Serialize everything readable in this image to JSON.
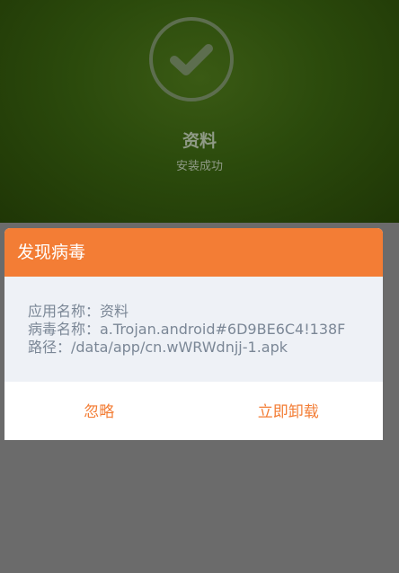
{
  "install_screen": {
    "app_name": "资料",
    "status": "安装成功",
    "status_icon": "check-circle-icon"
  },
  "virus_dialog": {
    "title": "发现病毒",
    "app_name_line": "应用名称：资料",
    "virus_name_line": "病毒名称：a.Trojan.android#6D9BE6C4!138F",
    "path_line": "路径：/data/app/cn.wWRWdnjj-1.apk",
    "ignore_label": "忽略",
    "uninstall_label": "立即卸载",
    "accent_color": "#f37d35"
  }
}
